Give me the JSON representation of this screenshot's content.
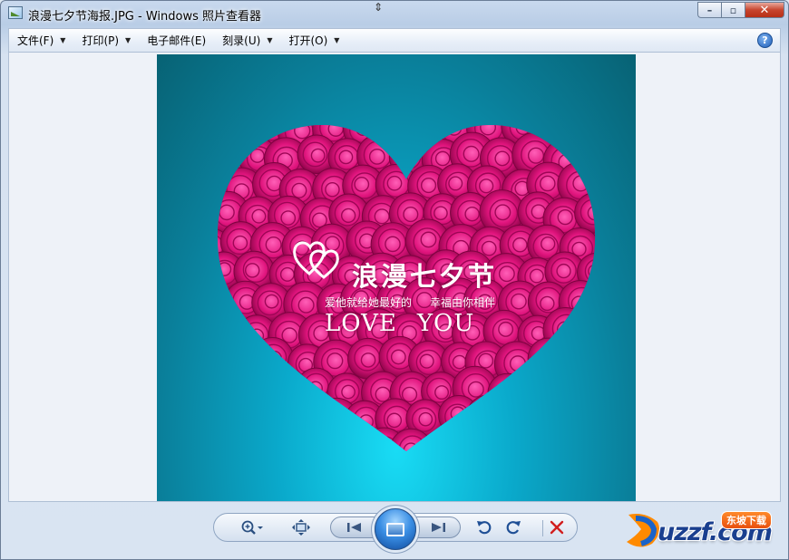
{
  "window": {
    "title": "浪漫七夕节海报.JPG - Windows 照片查看器",
    "controls": {
      "minimize": "–",
      "maximize": "▫",
      "close": "✕"
    }
  },
  "menu": {
    "items": [
      {
        "label": "文件(F)"
      },
      {
        "label": "打印(P)"
      },
      {
        "label": "电子邮件(E)"
      },
      {
        "label": "刻录(U)"
      },
      {
        "label": "打开(O)"
      }
    ],
    "help_icon": "question-mark-icon"
  },
  "poster": {
    "title": "浪漫七夕节",
    "sub_left": "爱他就给她最好的",
    "sub_right": "幸福由你相伴",
    "love_left": "LOVE",
    "love_right": "YOU",
    "colors": {
      "background_center": "#19dcf5",
      "background_edge": "#076274",
      "rose": "#e0147d"
    }
  },
  "toolbar": {
    "buttons": [
      {
        "name": "zoom-icon"
      },
      {
        "name": "actual-size-icon"
      },
      {
        "name": "previous-icon"
      },
      {
        "name": "slideshow-icon"
      },
      {
        "name": "next-icon"
      },
      {
        "name": "rotate-counterclockwise-icon"
      },
      {
        "name": "rotate-clockwise-icon"
      },
      {
        "name": "delete-icon"
      }
    ]
  },
  "watermark": {
    "text": "uzzf.com",
    "badge": "东坡下载"
  }
}
